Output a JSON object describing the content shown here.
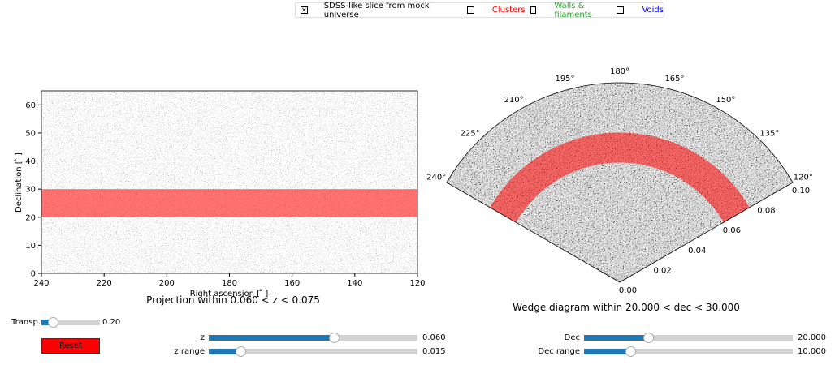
{
  "legend": {
    "items": [
      {
        "label": "SDSS-like slice from mock universe",
        "checked": true,
        "color": "#000000"
      },
      {
        "label": "Clusters",
        "checked": false,
        "color": "#ff0000"
      },
      {
        "label": "Walls & filaments",
        "checked": false,
        "color": "#2ca02c"
      },
      {
        "label": "Voids",
        "checked": false,
        "color": "#0000ff"
      }
    ]
  },
  "projection": {
    "title": "Projection within 0.060 < z < 0.075",
    "xlabel": "Right ascension [$^\\circ$]",
    "xlabel_display": "Right ascension [ ̊ ]",
    "ylabel": "Declination [ ̊ ]",
    "xticks": [
      "240",
      "220",
      "200",
      "180",
      "160",
      "140",
      "120"
    ],
    "xlim": [
      240,
      120
    ],
    "yticks": [
      "0",
      "10",
      "20",
      "30",
      "40",
      "50",
      "60"
    ],
    "ylim": [
      0,
      65
    ],
    "band": [
      20,
      30
    ],
    "band_color": "#ff0000"
  },
  "wedge": {
    "title": "Wedge diagram within 20.000 < dec < 30.000",
    "angle_ticks": [
      "120°",
      "135°",
      "150°",
      "165°",
      "180°",
      "195°",
      "210°",
      "225°",
      "240°"
    ],
    "radial_ticks": [
      "0.00",
      "0.02",
      "0.04",
      "0.06",
      "0.08",
      "0.10"
    ],
    "rlim": [
      0,
      0.1
    ],
    "band": [
      0.06,
      0.075
    ]
  },
  "controls": {
    "transp": {
      "label": "Transp.",
      "value": "0.20",
      "fraction": 0.2
    },
    "reset": "Reset",
    "z": {
      "label": "z",
      "value": "0.060",
      "fraction": 0.6
    },
    "z_range": {
      "label": "z range",
      "value": "0.015",
      "fraction": 0.15
    },
    "dec": {
      "label": "Dec",
      "value": "20.000",
      "fraction": 0.308
    },
    "dec_range": {
      "label": "Dec range",
      "value": "10.000",
      "fraction": 0.22
    }
  }
}
